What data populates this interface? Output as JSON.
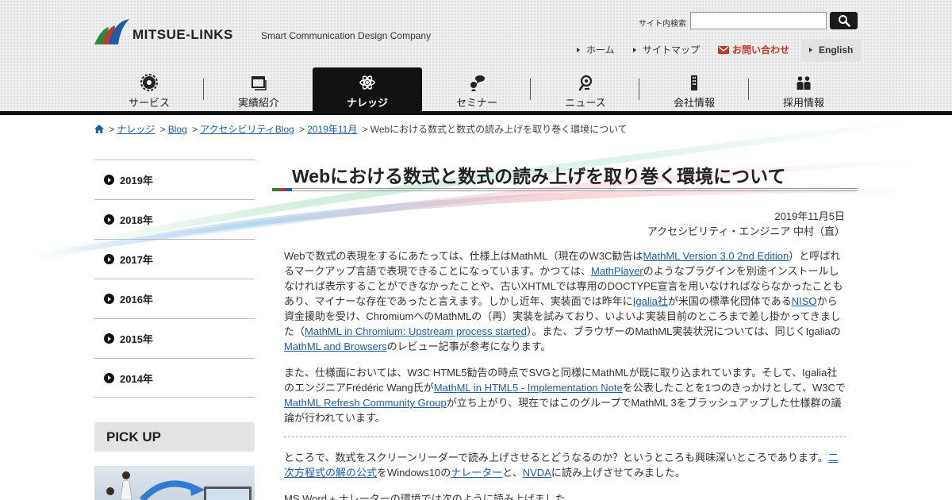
{
  "header": {
    "logo_text": "MITSUE-LINKS",
    "tagline": "Smart Communication Design Company",
    "search_label": "サイト内検索",
    "search_placeholder": "",
    "util_nav": [
      {
        "label": "ホーム"
      },
      {
        "label": "サイトマップ"
      },
      {
        "label": "お問い合わせ"
      },
      {
        "label": "English"
      }
    ]
  },
  "gnav": [
    {
      "label": "サービス",
      "icon": "gear-icon"
    },
    {
      "label": "実績紹介",
      "icon": "window-icon"
    },
    {
      "label": "ナレッジ",
      "icon": "atom-icon",
      "active": true
    },
    {
      "label": "セミナー",
      "icon": "speaker-icon"
    },
    {
      "label": "ニュース",
      "icon": "news-icon"
    },
    {
      "label": "会社情報",
      "icon": "building-icon"
    },
    {
      "label": "採用情報",
      "icon": "people-icon"
    }
  ],
  "breadcrumb": {
    "items": [
      "ナレッジ",
      "Blog",
      "アクセシビリティBlog",
      "2019年11月"
    ],
    "current": "Webにおける数式と数式の読み上げを取り巻く環境について"
  },
  "sidebar": {
    "years": [
      "2019年",
      "2018年",
      "2017年",
      "2016年",
      "2015年",
      "2014年"
    ],
    "pickup": "PICK UP"
  },
  "article": {
    "title": "Webにおける数式と数式の読み上げを取り巻く環境について",
    "date": "2019年11月5日",
    "author": "アクセシビリティ・エンジニア 中村（直）",
    "p1": [
      "Webで数式の表現をするにあたっては、仕様上はMathML（現在のW3C勧告は",
      "MathML Version 3.0 2nd Edition",
      "）と呼ばれるマークアップ言語で表現できることになっています。かつては、",
      "MathPlayer",
      "のようなプラグインを別途インストールしなければ表示することができなかったことや、古いXHTMLでは専用のDOCTYPE宣言を用いなければならなかったこともあり、マイナーな存在であったと言えます。しかし近年、実装面では昨年に",
      "Igalia社",
      "が米国の標準化団体である",
      "NISO",
      "から資金援助を受け、ChromiumへのMathMLの（再）実装を試みており、いよいよ実装目前のところまで差し掛かってきました（",
      "MathML in Chromium: Upstream process started",
      "）。また、ブラウザーのMathML実装状況については、同じくIgaliaの",
      "MathML and Browsers",
      "のレビュー記事が参考になります。"
    ],
    "p2": [
      "また、仕様面においては、W3C HTML5勧告の時点でSVGと同様にMathMLが既に取り込まれています。そして、Igalia社のエンジニアFrédéric Wang氏が",
      "MathML in HTML5 - Implementation Note",
      "を公表したことを1つのきっかけとして、W3Cで",
      "MathML Refresh Community Group",
      "が立ち上がり、現在ではこのグループでMathML 3をブラッシュアップした仕様群の議論が行われています。"
    ],
    "p3": [
      "ところで、数式をスクリーンリーダーで読み上げさせるとどうなるのか？というところも興味深いところであります。",
      "二次方程式の解の公式",
      "をWindows10の",
      "ナレーター",
      "と、",
      "NVDA",
      "に読み上げさせてみました。"
    ],
    "p4": "MS Word + ナレーターの環境では次のように読み上げました。"
  }
}
